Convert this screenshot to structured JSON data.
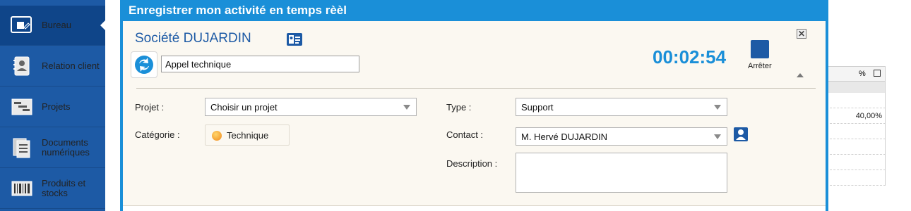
{
  "sidebar": {
    "items": [
      {
        "label": "Bureau",
        "icon": "desk-edit-icon",
        "active": true
      },
      {
        "label": "Relation client",
        "icon": "address-book-icon"
      },
      {
        "label": "Projets",
        "icon": "gantt-icon"
      },
      {
        "label": "Documents numériques",
        "icon": "documents-icon"
      },
      {
        "label": "Produits et stocks",
        "icon": "barcode-icon"
      }
    ]
  },
  "dialog": {
    "title": "Enregistrer mon activité en temps rèèl",
    "company": "Société DUJARDIN",
    "activity_value": "Appel technique",
    "timer": "00:02:54",
    "stop_label": "Arrêter",
    "fields": {
      "projet": {
        "label": "Projet :",
        "value": "Choisir un projet"
      },
      "categorie": {
        "label": "Catégorie :",
        "value": "Technique"
      },
      "type": {
        "label": "Type :",
        "value": "Support"
      },
      "contact": {
        "label": "Contact :",
        "value": "M. Hervé DUJARDIN"
      },
      "description": {
        "label": "Description :",
        "value": ""
      }
    }
  },
  "background_table": {
    "header_pct": "%",
    "row_value": "40,00%"
  },
  "colors": {
    "sidebar": "#1d5aa5",
    "title_bar": "#1a8fd8",
    "timer": "#1a8fd8",
    "dialog_bg": "#fbf8f1"
  }
}
